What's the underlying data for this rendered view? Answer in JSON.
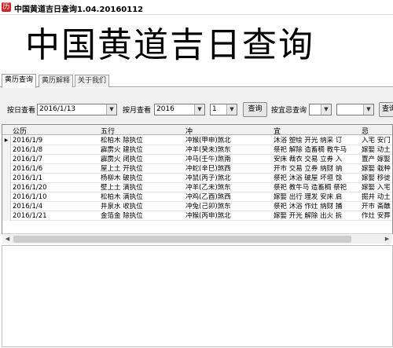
{
  "window": {
    "title": "中国黄道吉日查询1.04.20160112"
  },
  "banner": {
    "text": "中国黄道吉日查询"
  },
  "tabs": [
    {
      "label": "黄历查询",
      "active": true
    },
    {
      "label": "黄历解释",
      "active": false
    },
    {
      "label": "关于我们",
      "active": false
    }
  ],
  "toolbar": {
    "day_label": "按日查看",
    "day_value": "2016/1/13",
    "month_label": "按月查看",
    "year_value": "2016",
    "month_value": "1",
    "query_label": "查询",
    "yiji_label": "按宜忌查询",
    "yiji_value": "",
    "yiji_value2": "",
    "query2_label": "查询"
  },
  "grid": {
    "columns": [
      "公历",
      "五行",
      "冲",
      "宜",
      "忌"
    ],
    "rows": [
      {
        "date": "2016/1/9",
        "wuxing": "松柏木 除执位",
        "chong": "冲猴(甲申)煞北",
        "yi": "沐浴  塑绘  开光  纳采  订",
        "ji": "入宅  安门"
      },
      {
        "date": "2016/1/8",
        "wuxing": "霹雳火 建执位",
        "chong": "冲羊(癸未)煞东",
        "yi": "祭祀  解除  造畜稠  教牛马",
        "ji": "嫁娶  动土"
      },
      {
        "date": "2016/1/7",
        "wuxing": "霹雳火 闭执位",
        "chong": "冲马(壬午)煞南",
        "yi": "安床  裁衣  交易  立券  入",
        "ji": "置产  嫁娶"
      },
      {
        "date": "2016/1/6",
        "wuxing": "屋上土 开执位",
        "chong": "冲蛇(辛巳)煞西",
        "yi": "开市  交易  立券  纳财  纳",
        "ji": "嫁娶  栽种"
      },
      {
        "date": "2016/1/1",
        "wuxing": "杨柳木 破执位",
        "chong": "冲鼠(丙子)煞北",
        "yi": "祭祀  沐浴  破屋  坏垣  馀",
        "ji": "嫁娶  移徙"
      },
      {
        "date": "2016/1/20",
        "wuxing": "壁上土 满执位",
        "chong": "冲羊(乙未)煞东",
        "yi": "祭祀  教牛马  造畜稠  祭祀",
        "ji": "嫁娶  入宅"
      },
      {
        "date": "2016/1/10",
        "wuxing": "松柏木 满执位",
        "chong": "冲鸡(乙酉)煞西",
        "yi": "嫁娶  出行  理发  安床  启",
        "ji": "掘井  动土"
      },
      {
        "date": "2016/1/4",
        "wuxing": "井泉水 收执位",
        "chong": "冲兔(己卯)煞东",
        "yi": "祭祀  沐浴  作灶  纳财  捕",
        "ji": "开市  斋醮"
      },
      {
        "date": "2016/1/21",
        "wuxing": "金箔金 除执位",
        "chong": "冲猴(丙申)煞北",
        "yi": "嫁娶  开光  解除  出火  拆",
        "ji": "作灶  安葬"
      }
    ]
  },
  "icons": {
    "app": "calendar-app-icon",
    "row_pointer": "row-pointer-icon",
    "dropdown": "chevron-down-icon",
    "scroll_left": "scroll-left-icon",
    "scroll_right": "scroll-right-icon"
  }
}
